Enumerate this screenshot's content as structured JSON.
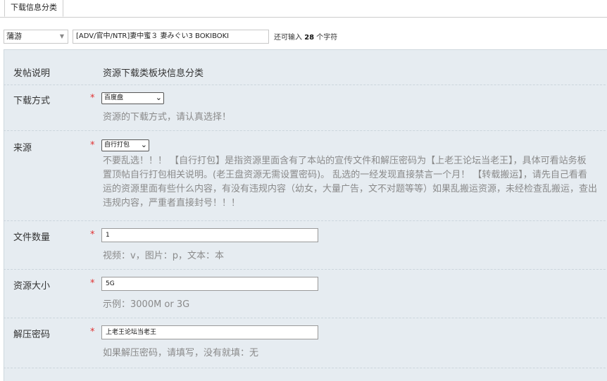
{
  "tabs": {
    "active": "下载信息分类"
  },
  "thread": {
    "type_value": "蒲游",
    "subject": "[ADV/官中/NTR]妻中蜜３ 妻みぐい3 BOKIBOKI",
    "remaining_prefix": "还可输入",
    "remaining_count": "28",
    "remaining_suffix": "个字符"
  },
  "form": {
    "header": {
      "label": "发帖说明",
      "value": "资源下载类板块信息分类"
    },
    "required_mark": "*",
    "download": {
      "label": "下载方式",
      "selected": "百度盘",
      "hint": "资源的下载方式，请认真选择！"
    },
    "source": {
      "label": "来源",
      "selected": "自行打包",
      "hint_lines": [
        "不要乱选！！！ 【自行打包】是指资源里面含有了本站的宣传文件和解压密码为【上老王论坛当老王】，具体可看站务板",
        "置顶帖自行打包相关说明。(老王盘资源无需设置密码)。 乱选的一经发现直接禁言一个月！ 【转载搬运】，请先自己看看",
        "运的资源里面有些什么内容，有没有违规内容（幼女，大量广告，文不对题等等）如果乱搬运资源，未经检查乱搬运，查出",
        "违规内容，严重者直接封号！！！"
      ]
    },
    "file_count": {
      "label": "文件数量",
      "value": "1",
      "hint": "视频：v，图片：p，文本：本"
    },
    "size": {
      "label": "资源大小",
      "value": "5G",
      "hint": "示例：3000M or 3G"
    },
    "password": {
      "label": "解压密码",
      "value": "上老王论坛当老王",
      "hint": "如果解压密码，请填写，没有就填：无"
    }
  },
  "icons": {
    "dropdown": "chevron-down-icon"
  },
  "colors": {
    "panel_bg": "#e6ecf1",
    "required": "#e03030",
    "hint": "#8a8a8a"
  }
}
